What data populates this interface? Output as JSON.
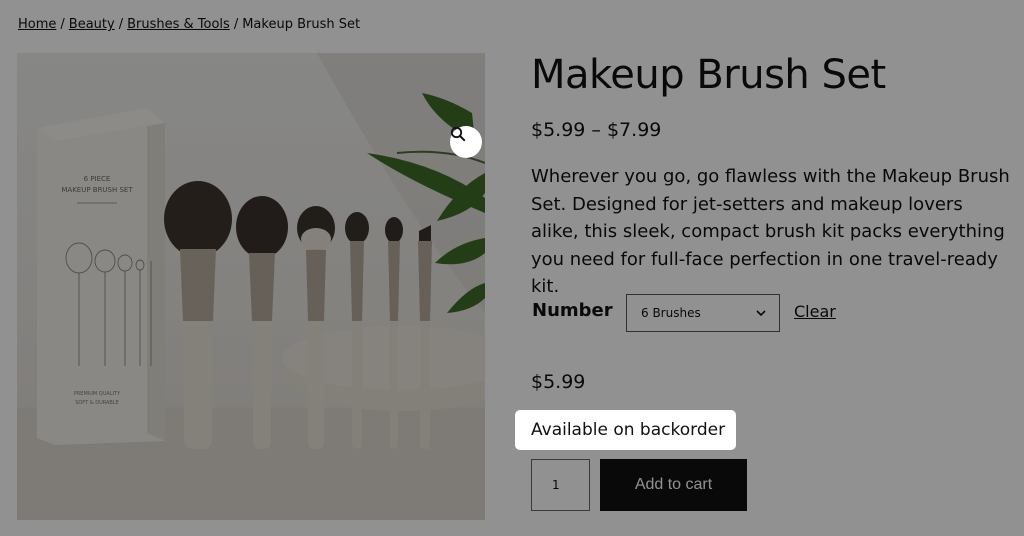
{
  "breadcrumb": {
    "items": [
      "Home",
      "Beauty",
      "Brushes & Tools"
    ],
    "separator": "/",
    "current": "Makeup Brush Set"
  },
  "image": {
    "box_line1": "6 PIECE",
    "box_line2": "MAKEUP BRUSH SET",
    "box_footer1": "PREMIUM QUALITY",
    "box_footer2": "SOFT & DURABLE",
    "zoom_icon": "search-icon"
  },
  "product": {
    "title": "Makeup Brush Set",
    "price_range": "$5.99 – $7.99",
    "description": "Wherever you go, go flawless with the Makeup Brush Set. Designed for jet-setters and makeup lovers alike, this sleek, compact brush kit packs everything you need for full-face perfection in one travel-ready kit."
  },
  "variation": {
    "label": "Number",
    "selected": "6 Brushes",
    "clear_label": "Clear"
  },
  "selected_variant": {
    "price": "$5.99",
    "stock": "Available on backorder"
  },
  "cart": {
    "quantity": "1",
    "add_label": "Add to cart"
  },
  "colors": {
    "overlay": "#000000",
    "button": "#111111",
    "highlight": "#ffffff"
  }
}
